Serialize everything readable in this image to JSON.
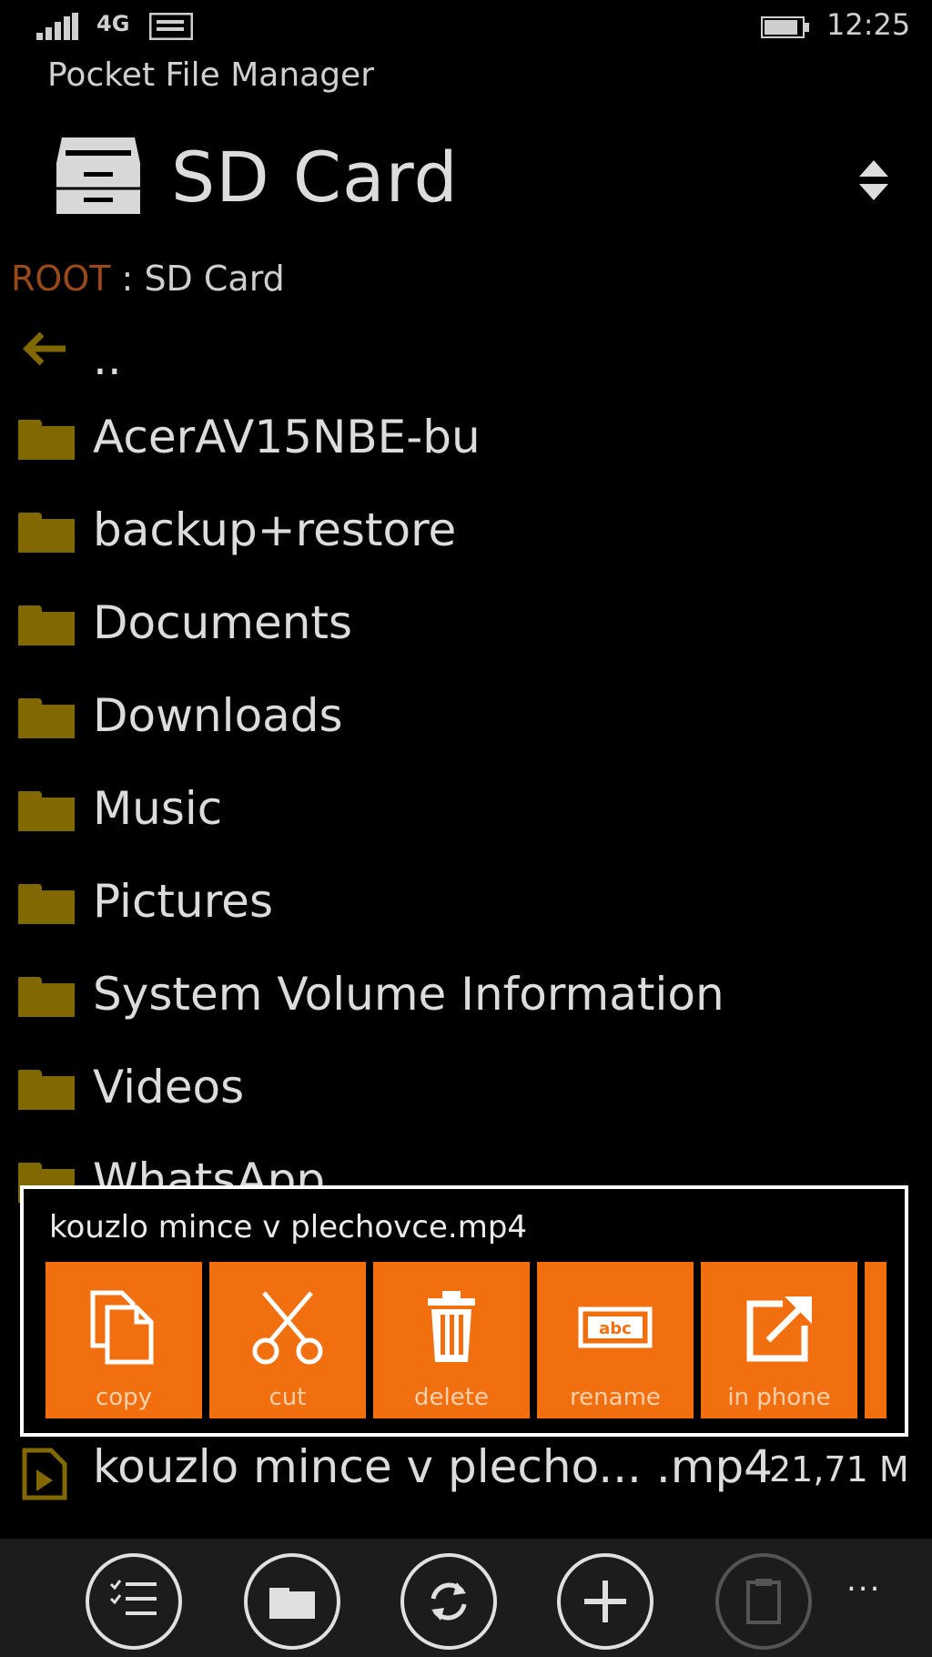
{
  "status_bar": {
    "network": "4G",
    "time": "12:25",
    "icons": [
      "signal-icon",
      "message-icon",
      "battery-icon"
    ]
  },
  "app": {
    "title": "Pocket File Manager"
  },
  "header": {
    "location_title": "SD Card",
    "icon": "drive-icon",
    "sort_icon": "sort-updown-icon"
  },
  "breadcrumb": {
    "root": "ROOT",
    "separator": ":",
    "path": "SD Card"
  },
  "list": {
    "up_label": "..",
    "folders": [
      {
        "name": "AcerAV15NBE-bu"
      },
      {
        "name": "backup+restore"
      },
      {
        "name": "Documents"
      },
      {
        "name": "Downloads"
      },
      {
        "name": "Music"
      },
      {
        "name": "Pictures"
      },
      {
        "name": "System Volume Information"
      },
      {
        "name": "Videos"
      },
      {
        "name": "WhatsApp"
      }
    ],
    "file": {
      "name": "kouzlo mince v plecho... .mp4",
      "size": "21,71 M"
    }
  },
  "context_menu": {
    "title": "kouzlo mince v plechovce.mp4",
    "actions": [
      {
        "label": "copy",
        "icon": "copy-icon"
      },
      {
        "label": "cut",
        "icon": "scissors-icon"
      },
      {
        "label": "delete",
        "icon": "trash-icon"
      },
      {
        "label": "rename",
        "icon": "rename-icon"
      },
      {
        "label": "in phone",
        "icon": "open-external-icon"
      }
    ]
  },
  "app_bar": {
    "buttons": [
      "list-icon",
      "folder-icon",
      "refresh-icon",
      "add-icon",
      "paste-icon"
    ],
    "more": "..."
  },
  "colors": {
    "accent": "#f26f0f",
    "folder": "#826800",
    "root_label": "#9a4a1a",
    "background": "#000000",
    "appbar": "#1c1c1c"
  }
}
